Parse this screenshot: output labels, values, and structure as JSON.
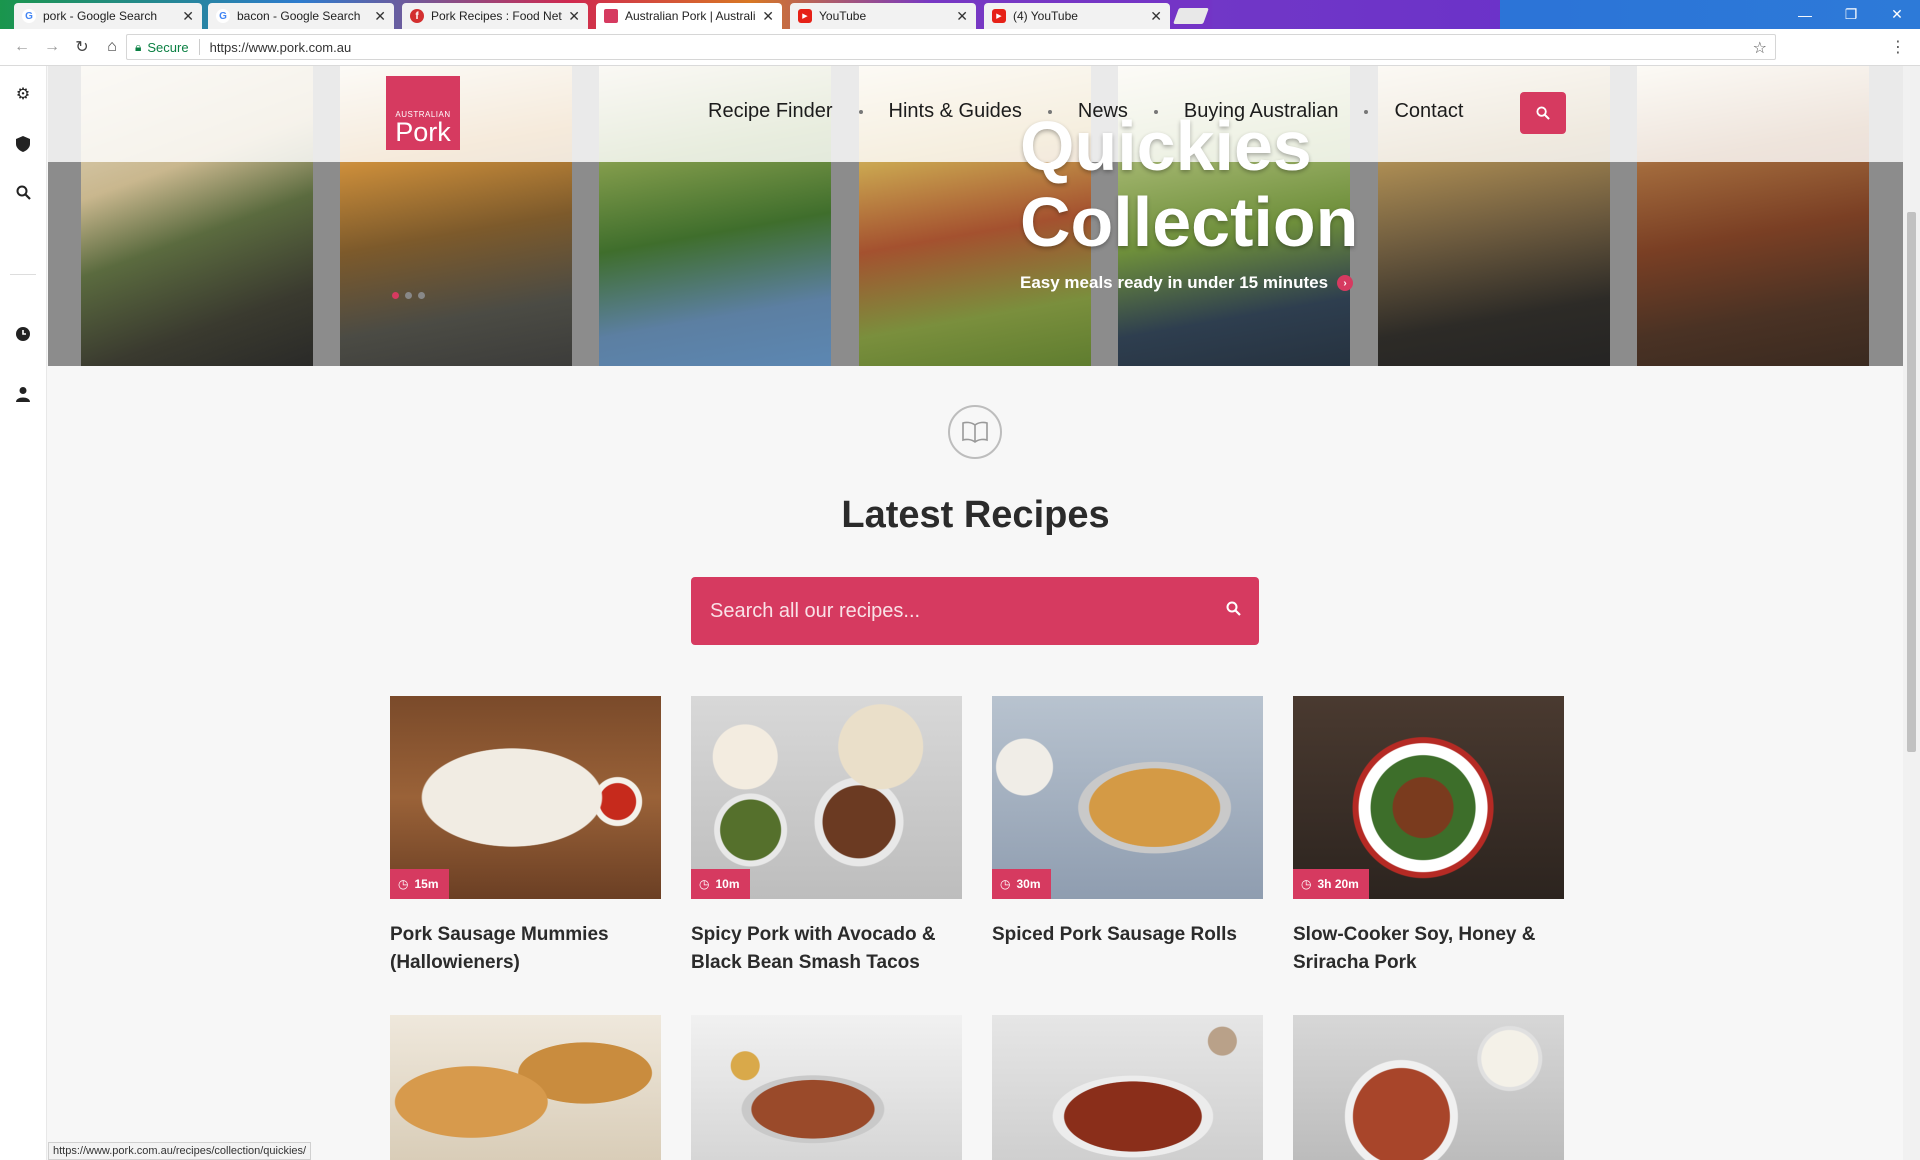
{
  "browser": {
    "tabs": [
      {
        "title": "pork - Google Search",
        "favicon": "google-icon",
        "active": false
      },
      {
        "title": "bacon - Google Search",
        "favicon": "google-icon",
        "active": false
      },
      {
        "title": "Pork Recipes : Food Netw",
        "favicon": "food-network-icon",
        "active": false
      },
      {
        "title": "Australian Pork | Australia",
        "favicon": "australian-pork-icon",
        "active": true
      },
      {
        "title": "YouTube",
        "favicon": "youtube-icon",
        "active": false
      },
      {
        "title": "(4) YouTube",
        "favicon": "youtube-icon",
        "active": false
      }
    ],
    "secure_label": "Secure",
    "url": "https://www.pork.com.au",
    "status_url": "https://www.pork.com.au/recipes/collection/quickies/"
  },
  "site": {
    "logo_small": "AUSTRALIAN",
    "logo_big": "Pork",
    "nav": [
      "Recipe Finder",
      "Hints & Guides",
      "News",
      "Buying Australian",
      "Contact"
    ],
    "hero_title_1": "Quickies",
    "hero_title_2": "Collection",
    "hero_subtitle": "Easy meals ready in under 15 minutes",
    "section_title": "Latest Recipes",
    "search_placeholder": "Search all our recipes..."
  },
  "recipes": [
    {
      "time": "15m",
      "name": "Pork Sausage Mummies (Hallowieners)"
    },
    {
      "time": "10m",
      "name": "Spicy Pork with Avocado & Black Bean Smash Tacos"
    },
    {
      "time": "30m",
      "name": "Spiced Pork Sausage Rolls"
    },
    {
      "time": "3h 20m",
      "name": "Slow-Cooker Soy, Honey & Sriracha Pork"
    }
  ],
  "colors": {
    "brand": "#d63a60"
  }
}
